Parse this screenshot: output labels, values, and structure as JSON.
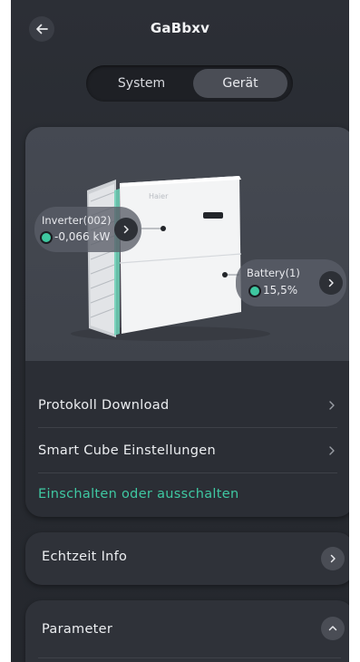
{
  "header": {
    "title": "GaBbxv"
  },
  "segment": {
    "system_label": "System",
    "geraet_label": "Gerät",
    "selected": "Gerät"
  },
  "device": {
    "brand_text": "Haier",
    "inverter": {
      "name": "Inverter(002)",
      "value": "-0,066 kW"
    },
    "battery": {
      "name": "Battery(1)",
      "value": "15,5%"
    }
  },
  "menu": {
    "protokoll": "Protokoll Download",
    "smart_cube": "Smart Cube Einstellungen",
    "toggle": "Einschalten oder ausschalten"
  },
  "echtzeit": {
    "label": "Echtzeit Info"
  },
  "parameter": {
    "label": "Parameter"
  },
  "colors": {
    "accent": "#3ec7a0",
    "background": "#2a2d33"
  },
  "icons": {
    "back": "arrow-left-icon",
    "chevron_right": "chevron-right-icon",
    "chevron_up": "chevron-up-icon",
    "status_dot": "status-dot-icon"
  }
}
